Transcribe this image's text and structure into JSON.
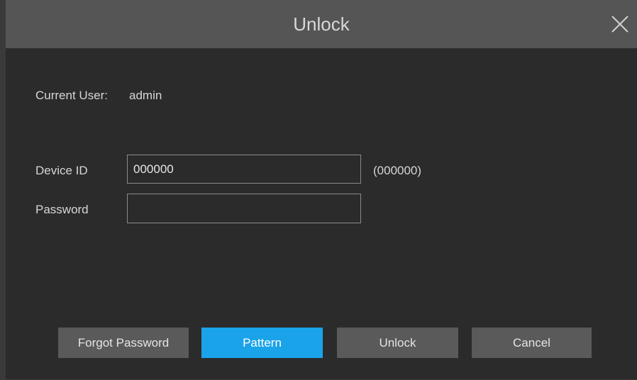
{
  "dialog": {
    "title": "Unlock",
    "close_icon": "close-icon"
  },
  "current_user": {
    "label": "Current User:",
    "value": "admin"
  },
  "device_id": {
    "label": "Device ID",
    "value": "000000",
    "hint": "(000000)"
  },
  "password": {
    "label": "Password",
    "value": ""
  },
  "buttons": {
    "forgot_password": "Forgot Password",
    "pattern": "Pattern",
    "unlock": "Unlock",
    "cancel": "Cancel"
  },
  "colors": {
    "accent": "#1aa3e8",
    "titlebar": "#555555",
    "background": "#2b2b2b"
  }
}
